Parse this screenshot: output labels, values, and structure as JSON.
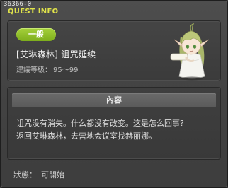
{
  "window": {
    "quest_id": "36366-0",
    "title": "QUEST INFO"
  },
  "quest": {
    "category": "一般",
    "title": "[艾琳森林] 诅咒延续",
    "level_label": "建議等級：",
    "level_range": "95～99"
  },
  "content": {
    "header": "內容",
    "lines": [
      "诅咒没有消失。什么都没有改变。这是怎么回事?",
      "返回艾琳森林，去营地会议室找赫丽娜。"
    ]
  },
  "status": {
    "label": "狀態：",
    "value": "可開始"
  },
  "colors": {
    "title_yellow": "#e0e34a",
    "badge_green": "#8fbf26"
  },
  "icons": {
    "npc": "elf-npc-portrait"
  }
}
